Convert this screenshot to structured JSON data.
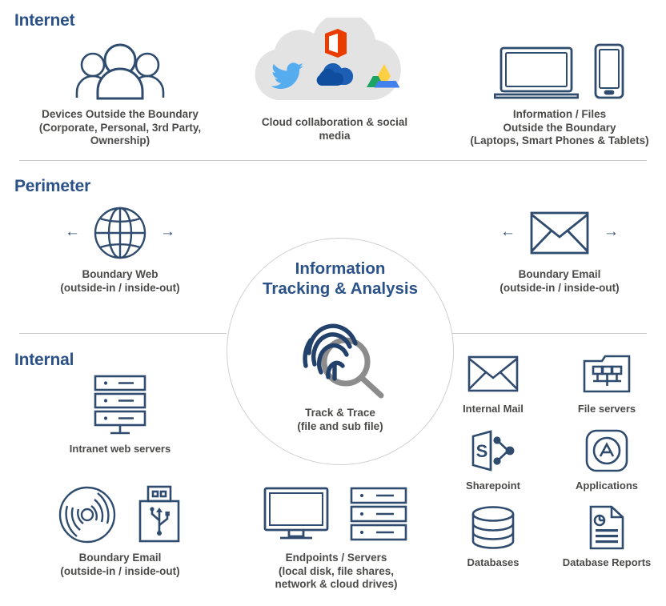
{
  "zones": [
    {
      "id": "internet",
      "label": "Internet"
    },
    {
      "id": "perimeter",
      "label": "Perimeter"
    },
    {
      "id": "internal",
      "label": "Internal"
    }
  ],
  "colors": {
    "heading_blue": "#2b5288",
    "icon_navy": "#2f4b6e",
    "body_text": "#4a4a48",
    "divider": "#c9c9c9",
    "cloud_grey": "#e3e3e3",
    "magnifier_grey": "#8c8c8c",
    "office_orange": "#eb3c00",
    "twitter_blue": "#55acee",
    "onedrive_blue": "#0f4d9e",
    "gdrive_green": "#1da462",
    "gdrive_yellow": "#ffcf44",
    "gdrive_blue": "#4081ec"
  },
  "internet": {
    "devices": {
      "icon": "people-group-icon",
      "caption": "Devices Outside the Boundary\n(Corporate, Personal, 3rd Party,\nOwnership)"
    },
    "cloud": {
      "icon": "cloud-icon",
      "brand_icons": [
        "office-365-icon",
        "twitter-icon",
        "onedrive-icon",
        "google-drive-icon"
      ],
      "caption": "Cloud collaboration & social\nmedia"
    },
    "files": {
      "icons": [
        "laptop-icon",
        "smartphone-icon"
      ],
      "caption": "Information / Files\nOutside the Boundary\n(Laptops, Smart Phones & Tablets)"
    }
  },
  "perimeter": {
    "web": {
      "icon": "globe-icon",
      "arrow_left": "←",
      "arrow_right": "→",
      "caption": "Boundary Web\n(outside-in / inside-out)"
    },
    "email": {
      "icon": "envelope-icon",
      "arrow_left": "←",
      "arrow_right": "→",
      "caption": "Boundary Email\n(outside-in / inside-out)"
    }
  },
  "hub": {
    "title": "Information\nTracking & Analysis",
    "icon": "fingerprint-magnifier-icon",
    "caption": "Track & Trace\n(file and sub file)"
  },
  "internal": {
    "intranet": {
      "icon": "server-rack-icon",
      "caption": "Intranet web servers"
    },
    "removable": {
      "icons": [
        "optical-disc-icon",
        "usb-drive-icon"
      ],
      "caption": "Boundary Email\n(outside-in / inside-out)"
    },
    "endpoints": {
      "icons": [
        "desktop-monitor-icon",
        "server-rack-icon"
      ],
      "caption": "Endpoints / Servers\n(local disk, file shares,\nnetwork & cloud drives)"
    },
    "apps": [
      {
        "icon": "envelope-icon",
        "label": "Internal Mail"
      },
      {
        "icon": "folder-network-icon",
        "label": "File servers"
      },
      {
        "icon": "sharepoint-icon",
        "label": "Sharepoint"
      },
      {
        "icon": "app-store-icon",
        "label": "Applications"
      },
      {
        "icon": "database-icon",
        "label": "Databases"
      },
      {
        "icon": "report-document-icon",
        "label": "Database Reports"
      }
    ]
  }
}
